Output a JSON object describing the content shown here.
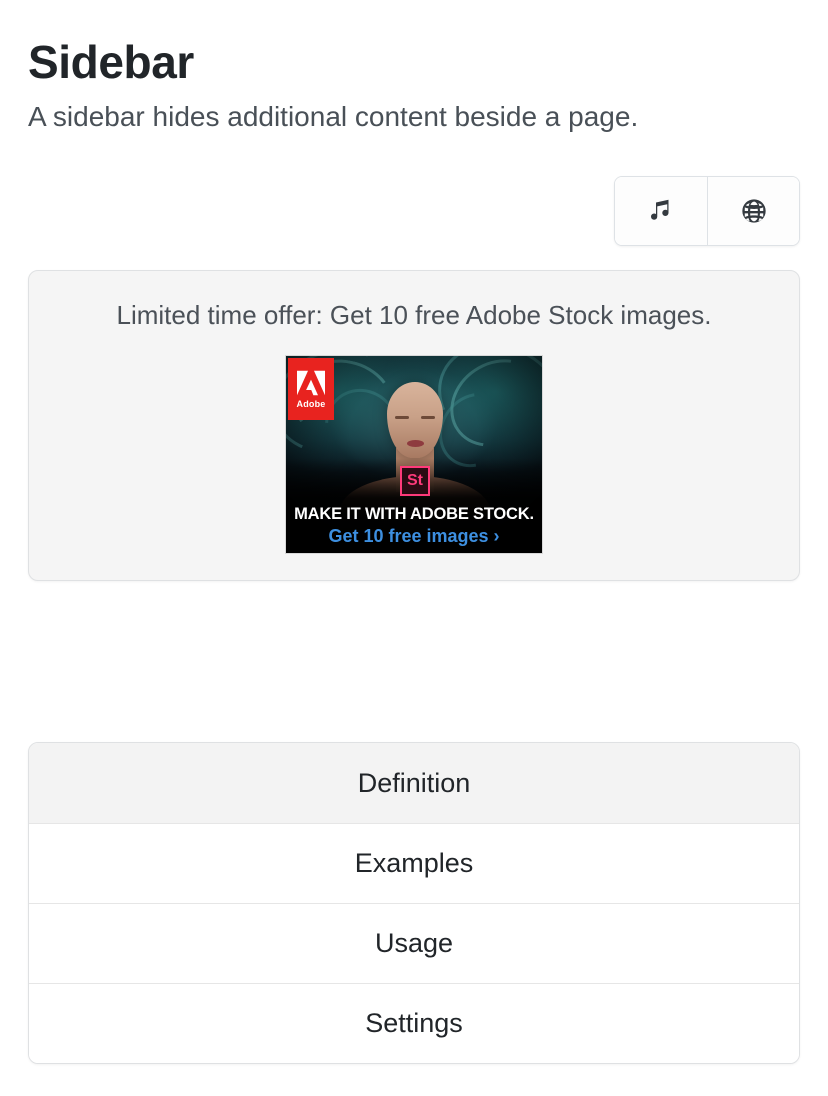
{
  "header": {
    "title": "Sidebar",
    "subtitle": "A sidebar hides additional content beside a page."
  },
  "toolbar": {
    "buttons": [
      {
        "name": "music-button",
        "icon": "music-note-icon",
        "label": "♫"
      },
      {
        "name": "globe-button",
        "icon": "globe-icon",
        "label": "🌐"
      }
    ]
  },
  "ad": {
    "headline": "Limited time offer: Get 10 free Adobe Stock images.",
    "banner": {
      "brand": "Adobe",
      "product_badge": "St",
      "tagline": "MAKE IT WITH ADOBE STOCK.",
      "cta": "Get 10 free images ›",
      "colors": {
        "adobe_red": "#e8231f",
        "badge_pink": "#ff3a7a",
        "cta_blue": "#3d8fe0",
        "background": "#0c1a24"
      }
    }
  },
  "list_group": {
    "items": [
      {
        "label": "Definition",
        "active": true
      },
      {
        "label": "Examples",
        "active": false
      },
      {
        "label": "Usage",
        "active": false
      },
      {
        "label": "Settings",
        "active": false
      }
    ]
  },
  "colors": {
    "title": "#212529",
    "subtitle": "#495057",
    "card_bg": "#f5f5f5",
    "border": "#dfe1e3",
    "active_item_bg": "#f3f3f3"
  }
}
